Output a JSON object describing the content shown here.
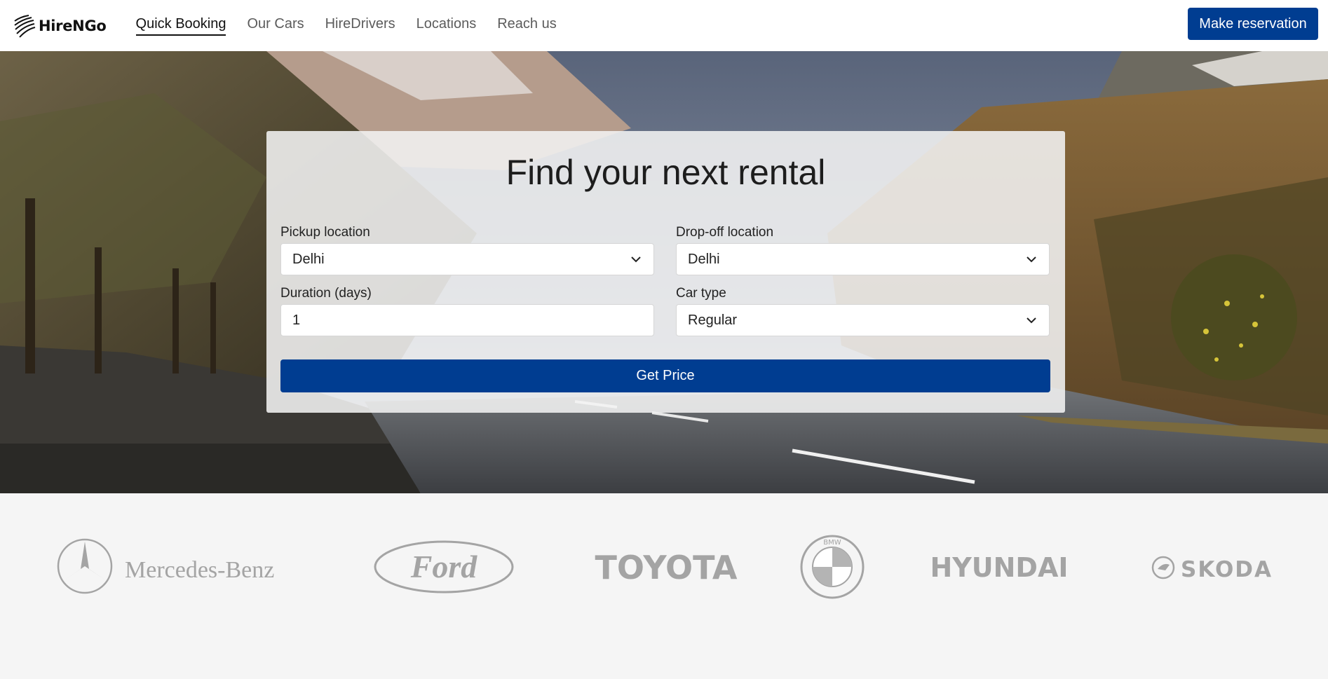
{
  "header": {
    "brand": "HireNGo",
    "nav": [
      {
        "label": "Quick Booking",
        "active": true
      },
      {
        "label": "Our Cars",
        "active": false
      },
      {
        "label": "HireDrivers",
        "active": false
      },
      {
        "label": "Locations",
        "active": false
      },
      {
        "label": "Reach us",
        "active": false
      }
    ],
    "cta_label": "Make reservation"
  },
  "booking": {
    "title": "Find your next rental",
    "pickup": {
      "label": "Pickup location",
      "value": "Delhi"
    },
    "dropoff": {
      "label": "Drop-off location",
      "value": "Delhi"
    },
    "duration": {
      "label": "Duration (days)",
      "value": "1"
    },
    "car_type": {
      "label": "Car type",
      "value": "Regular"
    },
    "submit_label": "Get Price"
  },
  "brands": {
    "mercedes": "Mercedes-Benz",
    "ford": "Ford",
    "toyota": "TOYOTA",
    "bmw": "BMW",
    "hyundai": "HYUNDAI",
    "skoda": "SKODA"
  },
  "colors": {
    "accent": "#003d91",
    "logo_gray": "#a4a4a4",
    "brand_strip_bg": "#f5f5f5"
  }
}
